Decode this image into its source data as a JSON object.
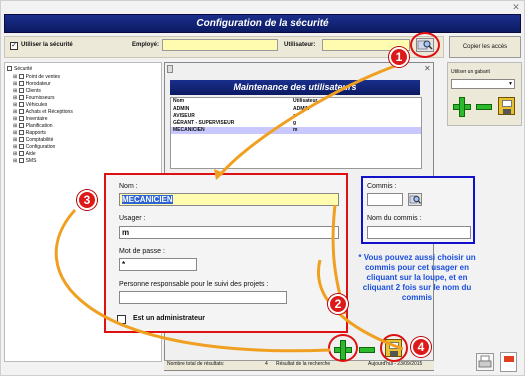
{
  "main": {
    "title": "Configuration de la sécurité",
    "use_security_label": "Utiliser la sécurité",
    "use_security_checked": true,
    "employee_label": "Employé:",
    "employee_value": "",
    "user_label": "Utilisateur:",
    "user_value": "",
    "copy_access_button": "Copier les accès",
    "template_label": "Utiliser un gabarit",
    "template_value": ""
  },
  "tree": {
    "root": "Sécurité",
    "items": [
      "Point de ventes",
      "Horodateur",
      "Clients",
      "Fournisseurs",
      "Véhicules",
      "Achats et Réceptions",
      "Inventaire",
      "Planification",
      "Rapports",
      "Comptabilité",
      "Configuration",
      "Aide",
      "SMS"
    ]
  },
  "dialog": {
    "title": "Maintenance des utilisateurs",
    "columns": [
      "Nom",
      "Utilisateur"
    ],
    "rows": [
      {
        "nom": "ADMIN",
        "utilisateur": "ADMIN"
      },
      {
        "nom": "AVISEUR",
        "utilisateur": "a"
      },
      {
        "nom": "GÉRANT - SUPERVISEUR",
        "utilisateur": "g"
      },
      {
        "nom": "MECANICIEN",
        "utilisateur": "m"
      }
    ],
    "selected_row": 3,
    "status_total_label": "Nombre total de résultats:",
    "status_total_value": "4",
    "status_search_label": "Résultat de la recherche",
    "status_date": "Aujourd'hui - 23/09/2015"
  },
  "form": {
    "nom_label": "Nom :",
    "nom_value": "MECANICIEN",
    "usager_label": "Usager :",
    "usager_value": "m",
    "password_label": "Mot de passe :",
    "password_value": "*",
    "responsible_label": "Personne responsable pour le suivi des projets :",
    "responsible_value": "",
    "admin_label": "Est un administrateur",
    "admin_checked": false,
    "commis_label": "Commis :",
    "commis_value": "",
    "commis_name_label": "Nom du commis :",
    "commis_name_value": ""
  },
  "annotations": {
    "badges": [
      "1",
      "2",
      "3",
      "4"
    ],
    "note": "* Vous pouvez aussi choisir un commis pour cet usager en cliquant sur la loupe, et en cliquant 2 fois sur le nom du commis",
    "colors": {
      "red": "#dd1111",
      "blue": "#1111cc",
      "orange": "#f0a020"
    }
  }
}
